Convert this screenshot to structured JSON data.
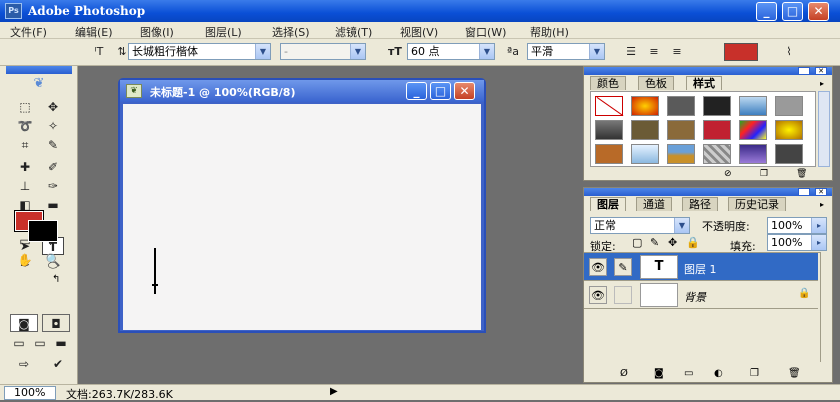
{
  "app": {
    "title": "Adobe Photoshop"
  },
  "menu": [
    "文件(F)",
    "编辑(E)",
    "图像(I)",
    "图层(L)",
    "选择(S)",
    "滤镜(T)",
    "视图(V)",
    "窗口(W)",
    "帮助(H)"
  ],
  "options": {
    "font_family": "长城粗行楷体",
    "font_style": "-",
    "font_size": "60 点",
    "aa_label": "a",
    "antialias": "平滑",
    "text_color": "#c8302a"
  },
  "colors": {
    "foreground": "#c8302a",
    "background": "#000000"
  },
  "document": {
    "title": "未标题-1 @ 100%(RGB/8)"
  },
  "styles_panel": {
    "tabs": [
      "颜色",
      "色板",
      "样式"
    ]
  },
  "layers_panel": {
    "tabs": [
      "图层",
      "通道",
      "路径",
      "历史记录"
    ],
    "blend_mode": "正常",
    "opacity_label": "不透明度:",
    "opacity": "100%",
    "lock_label": "锁定:",
    "fill_label": "填充:",
    "fill": "100%",
    "layers": [
      {
        "name": "图层 1",
        "thumb": "T",
        "selected": true
      },
      {
        "name": "背景",
        "thumb": "",
        "selected": false
      }
    ]
  },
  "status": {
    "zoom": "100%",
    "doc_info": "文档:263.7K/283.6K"
  }
}
